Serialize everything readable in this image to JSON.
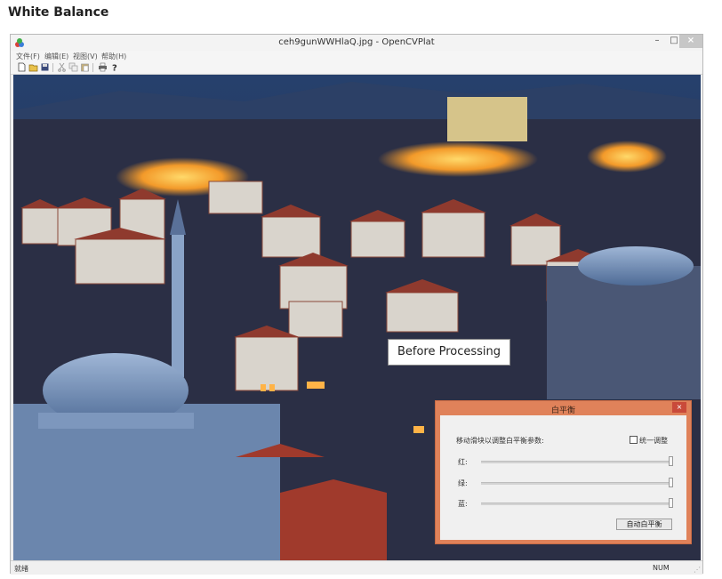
{
  "page": {
    "heading": "White Balance"
  },
  "window": {
    "title": "ceh9gunWWHlaQ.jpg - OpenCVPlat",
    "controls": {
      "minimize": "–",
      "maximize": "□",
      "close": "×"
    },
    "menu": [
      "文件(F)",
      "编辑(E)",
      "视图(V)",
      "帮助(H)"
    ],
    "toolbar_icons": [
      "new-icon",
      "open-icon",
      "save-icon",
      "cut-icon",
      "copy-icon",
      "paste-icon",
      "print-icon",
      "help-icon"
    ]
  },
  "overlay": {
    "before_label": "Before Processing"
  },
  "wb_dialog": {
    "title": "白平衡",
    "close": "×",
    "instruction": "移动滑块以调整白平衡参数:",
    "sync_checkbox": {
      "label": "统一调整",
      "checked": false
    },
    "sliders": [
      {
        "label": "红:",
        "value": 1.0
      },
      {
        "label": "绿:",
        "value": 1.0
      },
      {
        "label": "蓝:",
        "value": 1.0
      }
    ],
    "auto_button": "自动白平衡"
  },
  "status": {
    "left": "就绪",
    "num": "NUM"
  },
  "colors": {
    "dialog_frame": "#e0825a",
    "accent_close": "#c94a3a"
  }
}
